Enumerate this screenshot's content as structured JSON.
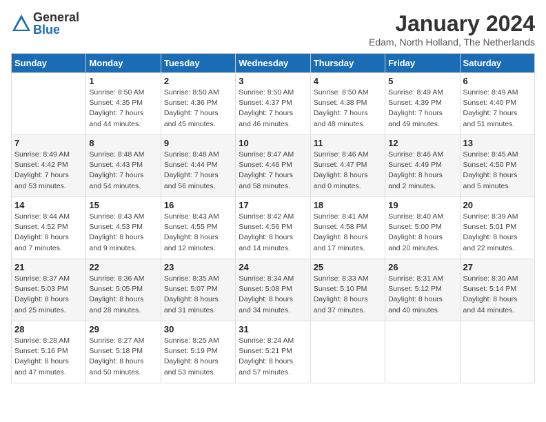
{
  "logo": {
    "general": "General",
    "blue": "Blue"
  },
  "title": "January 2024",
  "location": "Edam, North Holland, The Netherlands",
  "days_of_week": [
    "Sunday",
    "Monday",
    "Tuesday",
    "Wednesday",
    "Thursday",
    "Friday",
    "Saturday"
  ],
  "weeks": [
    [
      {
        "day": "",
        "info": ""
      },
      {
        "day": "1",
        "info": "Sunrise: 8:50 AM\nSunset: 4:35 PM\nDaylight: 7 hours\nand 44 minutes."
      },
      {
        "day": "2",
        "info": "Sunrise: 8:50 AM\nSunset: 4:36 PM\nDaylight: 7 hours\nand 45 minutes."
      },
      {
        "day": "3",
        "info": "Sunrise: 8:50 AM\nSunset: 4:37 PM\nDaylight: 7 hours\nand 46 minutes."
      },
      {
        "day": "4",
        "info": "Sunrise: 8:50 AM\nSunset: 4:38 PM\nDaylight: 7 hours\nand 48 minutes."
      },
      {
        "day": "5",
        "info": "Sunrise: 8:49 AM\nSunset: 4:39 PM\nDaylight: 7 hours\nand 49 minutes."
      },
      {
        "day": "6",
        "info": "Sunrise: 8:49 AM\nSunset: 4:40 PM\nDaylight: 7 hours\nand 51 minutes."
      }
    ],
    [
      {
        "day": "7",
        "info": "Sunrise: 8:49 AM\nSunset: 4:42 PM\nDaylight: 7 hours\nand 53 minutes."
      },
      {
        "day": "8",
        "info": "Sunrise: 8:48 AM\nSunset: 4:43 PM\nDaylight: 7 hours\nand 54 minutes."
      },
      {
        "day": "9",
        "info": "Sunrise: 8:48 AM\nSunset: 4:44 PM\nDaylight: 7 hours\nand 56 minutes."
      },
      {
        "day": "10",
        "info": "Sunrise: 8:47 AM\nSunset: 4:46 PM\nDaylight: 7 hours\nand 58 minutes."
      },
      {
        "day": "11",
        "info": "Sunrise: 8:46 AM\nSunset: 4:47 PM\nDaylight: 8 hours\nand 0 minutes."
      },
      {
        "day": "12",
        "info": "Sunrise: 8:46 AM\nSunset: 4:49 PM\nDaylight: 8 hours\nand 2 minutes."
      },
      {
        "day": "13",
        "info": "Sunrise: 8:45 AM\nSunset: 4:50 PM\nDaylight: 8 hours\nand 5 minutes."
      }
    ],
    [
      {
        "day": "14",
        "info": "Sunrise: 8:44 AM\nSunset: 4:52 PM\nDaylight: 8 hours\nand 7 minutes."
      },
      {
        "day": "15",
        "info": "Sunrise: 8:43 AM\nSunset: 4:53 PM\nDaylight: 8 hours\nand 9 minutes."
      },
      {
        "day": "16",
        "info": "Sunrise: 8:43 AM\nSunset: 4:55 PM\nDaylight: 8 hours\nand 12 minutes."
      },
      {
        "day": "17",
        "info": "Sunrise: 8:42 AM\nSunset: 4:56 PM\nDaylight: 8 hours\nand 14 minutes."
      },
      {
        "day": "18",
        "info": "Sunrise: 8:41 AM\nSunset: 4:58 PM\nDaylight: 8 hours\nand 17 minutes."
      },
      {
        "day": "19",
        "info": "Sunrise: 8:40 AM\nSunset: 5:00 PM\nDaylight: 8 hours\nand 20 minutes."
      },
      {
        "day": "20",
        "info": "Sunrise: 8:39 AM\nSunset: 5:01 PM\nDaylight: 8 hours\nand 22 minutes."
      }
    ],
    [
      {
        "day": "21",
        "info": "Sunrise: 8:37 AM\nSunset: 5:03 PM\nDaylight: 8 hours\nand 25 minutes."
      },
      {
        "day": "22",
        "info": "Sunrise: 8:36 AM\nSunset: 5:05 PM\nDaylight: 8 hours\nand 28 minutes."
      },
      {
        "day": "23",
        "info": "Sunrise: 8:35 AM\nSunset: 5:07 PM\nDaylight: 8 hours\nand 31 minutes."
      },
      {
        "day": "24",
        "info": "Sunrise: 8:34 AM\nSunset: 5:08 PM\nDaylight: 8 hours\nand 34 minutes."
      },
      {
        "day": "25",
        "info": "Sunrise: 8:33 AM\nSunset: 5:10 PM\nDaylight: 8 hours\nand 37 minutes."
      },
      {
        "day": "26",
        "info": "Sunrise: 8:31 AM\nSunset: 5:12 PM\nDaylight: 8 hours\nand 40 minutes."
      },
      {
        "day": "27",
        "info": "Sunrise: 8:30 AM\nSunset: 5:14 PM\nDaylight: 8 hours\nand 44 minutes."
      }
    ],
    [
      {
        "day": "28",
        "info": "Sunrise: 8:28 AM\nSunset: 5:16 PM\nDaylight: 8 hours\nand 47 minutes."
      },
      {
        "day": "29",
        "info": "Sunrise: 8:27 AM\nSunset: 5:18 PM\nDaylight: 8 hours\nand 50 minutes."
      },
      {
        "day": "30",
        "info": "Sunrise: 8:25 AM\nSunset: 5:19 PM\nDaylight: 8 hours\nand 53 minutes."
      },
      {
        "day": "31",
        "info": "Sunrise: 8:24 AM\nSunset: 5:21 PM\nDaylight: 8 hours\nand 57 minutes."
      },
      {
        "day": "",
        "info": ""
      },
      {
        "day": "",
        "info": ""
      },
      {
        "day": "",
        "info": ""
      }
    ]
  ]
}
